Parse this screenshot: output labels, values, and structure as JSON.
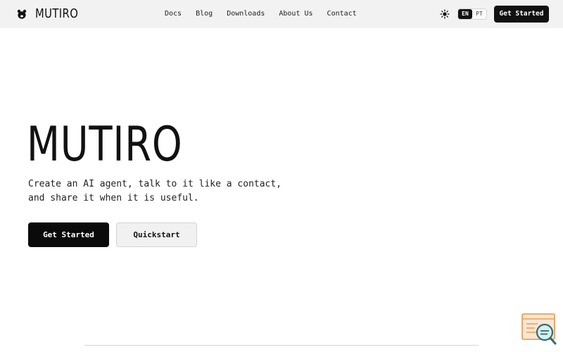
{
  "header": {
    "brand": "MUTIRO",
    "nav": [
      {
        "label": "Docs"
      },
      {
        "label": "Blog"
      },
      {
        "label": "Downloads"
      },
      {
        "label": "About Us"
      },
      {
        "label": "Contact"
      }
    ],
    "theme_icon": "sun-icon",
    "languages": [
      {
        "label": "EN",
        "active": true
      },
      {
        "label": "PT",
        "active": false
      }
    ],
    "cta_label": "Get Started"
  },
  "hero": {
    "title": "MUTIRO",
    "subtitle_line1": "Create an AI agent, talk to it like a contact,",
    "subtitle_line2": "and share it when it is useful.",
    "primary_label": "Get Started",
    "secondary_label": "Quickstart"
  },
  "widget": {
    "icon": "search-assistant-icon",
    "accent": "#e8a060"
  },
  "colors": {
    "topbar_bg": "#f2f2f2",
    "primary": "#111111",
    "secondary_bg": "#f1f1f1"
  }
}
